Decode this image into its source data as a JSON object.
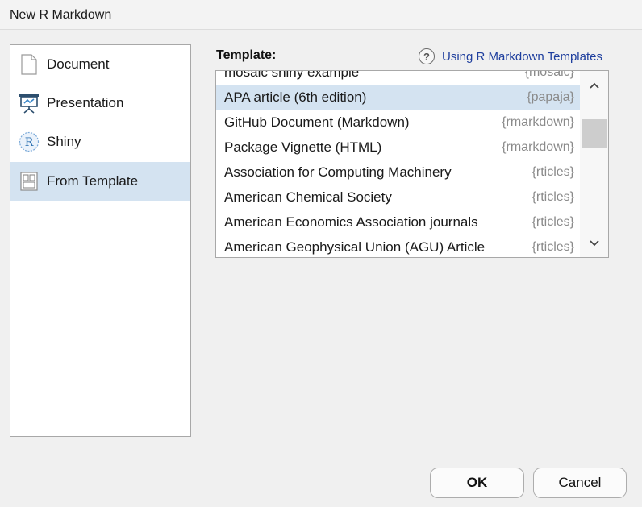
{
  "window": {
    "title": "New R Markdown"
  },
  "sidebar": {
    "items": [
      {
        "label": "Document",
        "icon": "document-icon",
        "selected": false
      },
      {
        "label": "Presentation",
        "icon": "presentation-icon",
        "selected": false
      },
      {
        "label": "Shiny",
        "icon": "r-shiny-icon",
        "selected": false
      },
      {
        "label": "From Template",
        "icon": "template-icon",
        "selected": true
      }
    ]
  },
  "template": {
    "heading": "Template:",
    "help_icon_glyph": "?",
    "help_link": "Using R Markdown Templates",
    "rows": [
      {
        "name": "mosaic shiny example",
        "pkg": "{mosaic}"
      },
      {
        "name": "APA article (6th edition)",
        "pkg": "{papaja}",
        "selected": true
      },
      {
        "name": "GitHub Document (Markdown)",
        "pkg": "{rmarkdown}"
      },
      {
        "name": "Package Vignette (HTML)",
        "pkg": "{rmarkdown}"
      },
      {
        "name": "Association for Computing Machinery",
        "pkg": "{rticles}"
      },
      {
        "name": "American Chemical Society",
        "pkg": "{rticles}"
      },
      {
        "name": "American Economics Association journals",
        "pkg": "{rticles}"
      },
      {
        "name": "American Geophysical Union (AGU) Article",
        "pkg": "{rticles}"
      }
    ]
  },
  "buttons": {
    "ok": "OK",
    "cancel": "Cancel"
  },
  "colors": {
    "selection": "#d4e3f1",
    "link": "#1f3f9e",
    "package_text": "#8a8a8a"
  }
}
